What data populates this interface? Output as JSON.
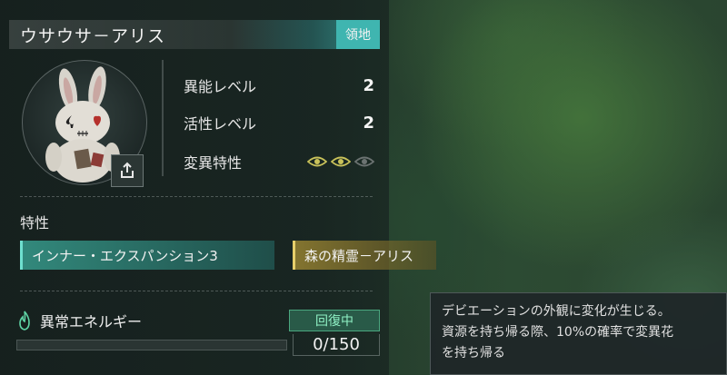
{
  "character": {
    "name": "ウサウサ－アリス",
    "tag": "領地"
  },
  "stats": [
    {
      "label": "異能レベル",
      "value": "2"
    },
    {
      "label": "活性レベル",
      "value": "2"
    }
  ],
  "mutation": {
    "label": "変異特性",
    "eyes_active": 2,
    "eyes_total": 3,
    "active_color": "#c9c25a",
    "inactive_color": "#6c7372"
  },
  "traits": {
    "heading": "特性",
    "items": [
      {
        "label": "インナー・エクスパンション3",
        "color": "#3b9c8c"
      },
      {
        "label": "森の精霊－アリス",
        "color": "#a08c3a"
      }
    ]
  },
  "energy": {
    "label": "異常エネルギー",
    "status": "回復中",
    "current": 0,
    "max": 150,
    "count_text": "0/150"
  },
  "tooltip": {
    "lines": [
      "デビエーションの外観に変化が生じる。",
      "資源を持ち帰る際、10%の確率で変異花",
      "を持ち帰る"
    ]
  }
}
